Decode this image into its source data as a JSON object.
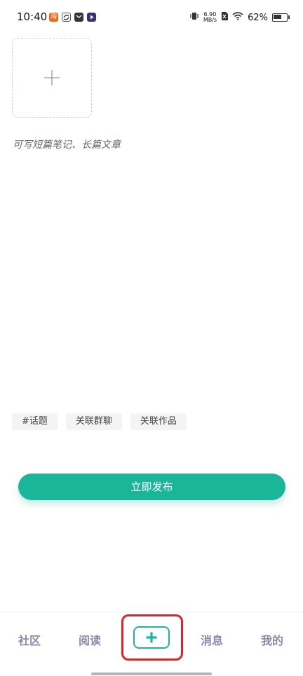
{
  "status_bar": {
    "time": "10:40",
    "net_speed_value": "6.90",
    "net_speed_unit": "MB/s",
    "battery": "62%"
  },
  "editor": {
    "placeholder": "可写短篇笔记、长篇文章"
  },
  "tags": [
    {
      "label": "#话题"
    },
    {
      "label": "关联群聊"
    },
    {
      "label": "关联作品"
    }
  ],
  "publish_label": "立即发布",
  "nav": [
    {
      "label": "社区"
    },
    {
      "label": "阅读"
    },
    {
      "label": "消息"
    },
    {
      "label": "我的"
    }
  ],
  "colors": {
    "accent": "#1bb59a",
    "nav_text": "#8c89a8",
    "highlight": "#e0232b"
  }
}
